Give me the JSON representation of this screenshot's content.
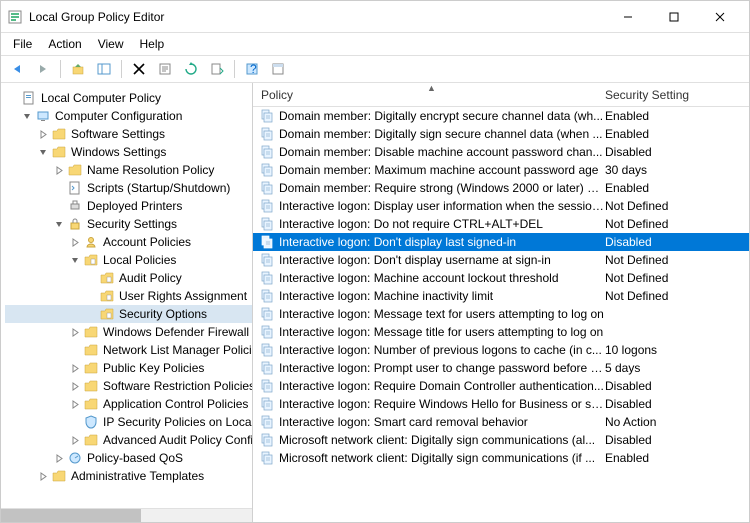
{
  "window": {
    "title": "Local Group Policy Editor"
  },
  "menu": {
    "file": "File",
    "action": "Action",
    "view": "View",
    "help": "Help"
  },
  "tree": {
    "root": "Local Computer Policy",
    "cc": "Computer Configuration",
    "ss": "Software Settings",
    "ws": "Windows Settings",
    "nrp": "Name Resolution Policy",
    "scripts": "Scripts (Startup/Shutdown)",
    "dp": "Deployed Printers",
    "sec": "Security Settings",
    "ap": "Account Policies",
    "lp": "Local Policies",
    "audit": "Audit Policy",
    "ura": "User Rights Assignment",
    "so": "Security Options",
    "wdf": "Windows Defender Firewall with Advanced Security",
    "nlmp": "Network List Manager Policies",
    "pkp": "Public Key Policies",
    "srp": "Software Restriction Policies",
    "acp": "Application Control Policies",
    "ipsec": "IP Security Policies on Local Computer",
    "aapc": "Advanced Audit Policy Configuration",
    "qos": "Policy-based QoS",
    "at": "Administrative Templates"
  },
  "list": {
    "header_policy": "Policy",
    "header_setting": "Security Setting",
    "rows": [
      {
        "p": "Domain member: Digitally encrypt secure channel data (wh...",
        "v": "Enabled"
      },
      {
        "p": "Domain member: Digitally sign secure channel data (when ...",
        "v": "Enabled"
      },
      {
        "p": "Domain member: Disable machine account password chan...",
        "v": "Disabled"
      },
      {
        "p": "Domain member: Maximum machine account password age",
        "v": "30 days"
      },
      {
        "p": "Domain member: Require strong (Windows 2000 or later) se...",
        "v": "Enabled"
      },
      {
        "p": "Interactive logon: Display user information when the session...",
        "v": "Not Defined"
      },
      {
        "p": "Interactive logon: Do not require CTRL+ALT+DEL",
        "v": "Not Defined"
      },
      {
        "p": "Interactive logon: Don't display last signed-in",
        "v": "Disabled"
      },
      {
        "p": "Interactive logon: Don't display username at sign-in",
        "v": "Not Defined"
      },
      {
        "p": "Interactive logon: Machine account lockout threshold",
        "v": "Not Defined"
      },
      {
        "p": "Interactive logon: Machine inactivity limit",
        "v": "Not Defined"
      },
      {
        "p": "Interactive logon: Message text for users attempting to log on",
        "v": ""
      },
      {
        "p": "Interactive logon: Message title for users attempting to log on",
        "v": ""
      },
      {
        "p": "Interactive logon: Number of previous logons to cache (in c...",
        "v": "10 logons"
      },
      {
        "p": "Interactive logon: Prompt user to change password before e...",
        "v": "5 days"
      },
      {
        "p": "Interactive logon: Require Domain Controller authentication...",
        "v": "Disabled"
      },
      {
        "p": "Interactive logon: Require Windows Hello for Business or sm...",
        "v": "Disabled"
      },
      {
        "p": "Interactive logon: Smart card removal behavior",
        "v": "No Action"
      },
      {
        "p": "Microsoft network client: Digitally sign communications (al...",
        "v": "Disabled"
      },
      {
        "p": "Microsoft network client: Digitally sign communications (if ...",
        "v": "Enabled"
      }
    ]
  }
}
